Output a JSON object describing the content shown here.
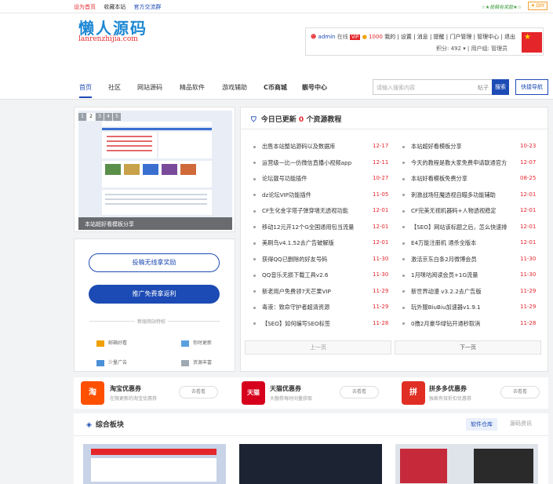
{
  "topbar": {
    "links": [
      "设为首页",
      "收藏本站",
      "官方交流群"
    ],
    "promo": "☆★投稿有奖励★☆",
    "diy": "✦ DIY"
  },
  "logo": {
    "cn": "懒人源码",
    "en": "lanrenzhijia.com"
  },
  "user": {
    "name": "admin",
    "status": "在线",
    "badge": "VIP",
    "points_label": "1000",
    "links": [
      "我的",
      "设置",
      "消息",
      "提醒",
      "门户管理",
      "管理中心",
      "退出"
    ],
    "credits": "积分: 492",
    "group": "用户组: 管理员"
  },
  "nav": {
    "items": [
      "首页",
      "社区",
      "网站源码",
      "精品软件",
      "游戏辅助",
      "C币商城",
      "靓号中心"
    ],
    "search_placeholder": "请输入搜索内容",
    "search_select": "帖子",
    "search_btn": "搜索",
    "quick_btn": "快捷导航"
  },
  "slider": {
    "pages": [
      "1",
      "2",
      "3",
      "4",
      "5"
    ],
    "caption": "本站超好看模板分享"
  },
  "side": {
    "btn1": "投稿无线拿奖励",
    "btn2": "推广免费拿返利",
    "perk_title": "新版网站特权",
    "perks": [
      "邮箱好看",
      "你时更新",
      "少量广告",
      "资源丰富"
    ]
  },
  "list": {
    "head_prefix": "今日已更新",
    "count": "0",
    "head_suffix": "个资源教程",
    "left": [
      {
        "t": "出售本站整站源码以及数据库",
        "d": "12-17"
      },
      {
        "t": "运营级一比一仿微信直播小视频app",
        "d": "12-11"
      },
      {
        "t": "论坛靓号功能插件",
        "d": "10-27"
      },
      {
        "t": "dz论坛VIP功能插件",
        "d": "11-05"
      },
      {
        "t": "CF生化金字塔子弹穿墙无透视功能",
        "d": "12-01"
      },
      {
        "t": "移动12元开12个G全国通用包当流量",
        "d": "12-01"
      },
      {
        "t": "美刷鸟v4.1.52去广告破解版",
        "d": "12-01"
      },
      {
        "t": "获得QQ已删除的好友号码",
        "d": "11-30"
      },
      {
        "t": "QQ音乐无损下载工具v2.6",
        "d": "11-30"
      },
      {
        "t": "新老用户免费领7天芒果VIP",
        "d": "11-29"
      },
      {
        "t": "毒液：致命守护者超清资源",
        "d": "11-29"
      },
      {
        "t": "【SEO】如何编写SEO标签",
        "d": "11-28"
      }
    ],
    "right": [
      {
        "t": "本站超好看模板分享",
        "d": "10-23"
      },
      {
        "t": "今天的教程是教大家免费申请联通官方",
        "d": "12-07"
      },
      {
        "t": "本站好看模板免费分享",
        "d": "08-25"
      },
      {
        "t": "刺激战场狂魔透视自瞄多功能辅助",
        "d": "12-01"
      },
      {
        "t": "CF完美无视机器码+人物透视稳定",
        "d": "12-01"
      },
      {
        "t": "【SEO】网站该标题之后，怎么快速排",
        "d": "12-01"
      },
      {
        "t": "E4万能注册机 通杀全版本",
        "d": "12-01"
      },
      {
        "t": "激活京东白条2月微博会员",
        "d": "11-30"
      },
      {
        "t": "1月咪咕阅读会员+1G流量",
        "d": "11-30"
      },
      {
        "t": "新世界动漫 v3.2.2去广告版",
        "d": "11-29"
      },
      {
        "t": "玩外服BiuBiu加速器v1.9.1",
        "d": "11-29"
      },
      {
        "t": "0撸2月豪华绿钻开通秒取消",
        "d": "11-28"
      }
    ],
    "prev": "上一页",
    "next": "下一页"
  },
  "coupons": [
    {
      "logo": "淘",
      "title": "淘宝优惠券",
      "sub": "在限更新的淘宝优惠券",
      "btn": "去看看",
      "color": "#ff5000"
    },
    {
      "logo": "天猫",
      "title": "天猫优惠券",
      "sub": "大额券每时间量获取",
      "btn": "去看看",
      "color": "#d6001c"
    },
    {
      "logo": "拼",
      "title": "拼多多优惠券",
      "sub": "独家有效折扣优惠券",
      "btn": "去看看",
      "color": "#e02e24"
    }
  ],
  "section": {
    "title": "综合板块",
    "tabs": [
      "软件仓库",
      "源码资讯"
    ]
  }
}
